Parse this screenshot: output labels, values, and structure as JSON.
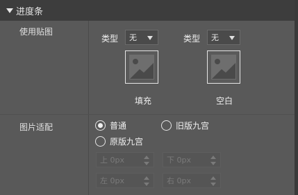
{
  "section": {
    "title": "进度条"
  },
  "labels": {
    "use_texture": "使用贴图",
    "image_fit": "图片适配"
  },
  "fill": {
    "type_label": "类型",
    "type_value": "无",
    "caption": "填充"
  },
  "blank": {
    "type_label": "类型",
    "type_value": "无",
    "caption": "空白"
  },
  "fit_options": [
    {
      "label": "普通",
      "selected": true
    },
    {
      "label": "旧版九宫",
      "selected": false
    },
    {
      "label": "原版九宫",
      "selected": false
    }
  ],
  "nine_slice": {
    "top": "上 0px",
    "bottom": "下 0px",
    "left": "左 0px",
    "right": "右 0px"
  },
  "colors": {
    "panel_bg": "#595959",
    "header_bg": "#3d3d3d",
    "text": "#f0f0f0",
    "disabled_text": "#7a7a7a"
  }
}
